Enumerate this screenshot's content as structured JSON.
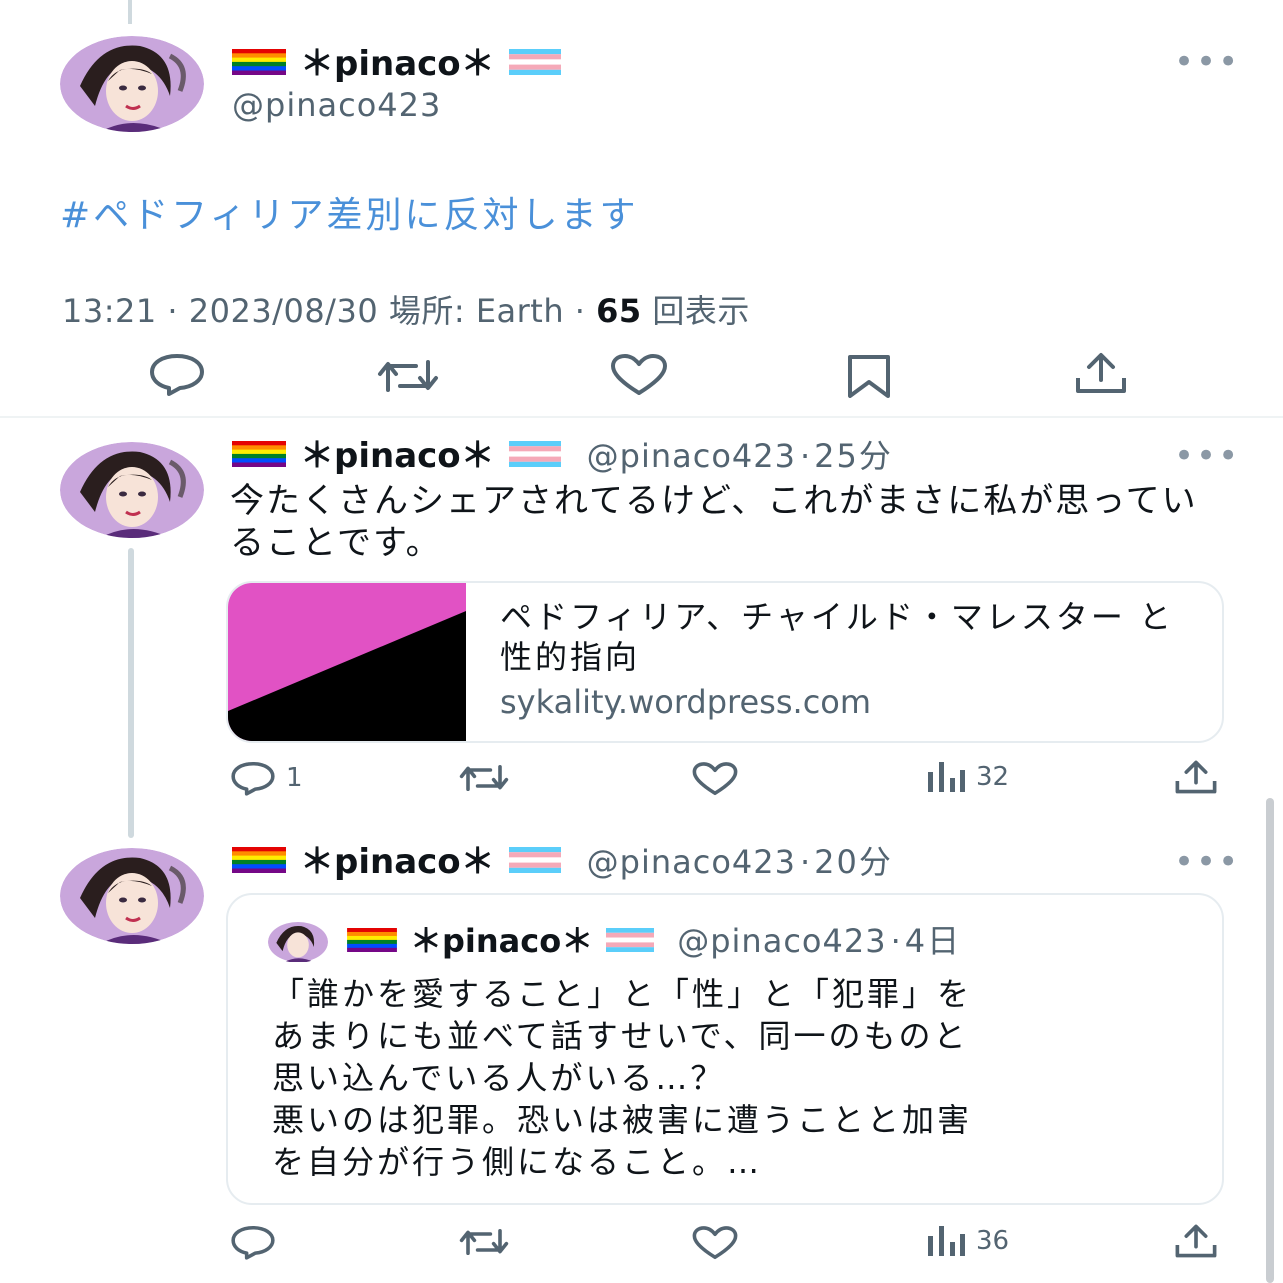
{
  "author": {
    "display_name": "＊pinaco＊",
    "handle": "@pinaco423"
  },
  "main_tweet": {
    "hashtag": "#ペドフィリア差別に反対します",
    "time": "13:21",
    "date": "2023/08/30",
    "location_label": "場所:",
    "location": "Earth",
    "view_count": "65",
    "view_label": "回表示"
  },
  "reply1": {
    "separator": "·",
    "time_ago": "25分",
    "text": "今たくさんシェアされてるけど、これがまさに私が思っていることです。",
    "card": {
      "title": "ペドフィリア、チャイルド・マレスター と性的指向",
      "domain": "sykality.wordpress.com"
    },
    "replies": "1",
    "views": "32"
  },
  "reply2": {
    "separator": "·",
    "time_ago": "20分",
    "quote": {
      "time_ago": "4日",
      "lines": [
        "「誰かを愛すること」と「性」と「犯罪」を",
        "あまりにも並べて話すせいで、同一のものと",
        "思い込んでいる人がいる…？",
        "悪いのは犯罪。恐いは被害に遭うことと加害",
        "を自分が行う側になること。…"
      ]
    },
    "views": "36"
  },
  "icons": {
    "more": "more-dots-icon",
    "reply": "reply-icon",
    "retweet": "retweet-icon",
    "like": "heart-icon",
    "bookmark": "bookmark-icon",
    "share": "share-icon",
    "views": "views-chart-icon"
  },
  "colors": {
    "hashtag": "#4a90d9",
    "muted": "#536471",
    "card_pink": "#e152c4",
    "card_black": "#000000"
  }
}
